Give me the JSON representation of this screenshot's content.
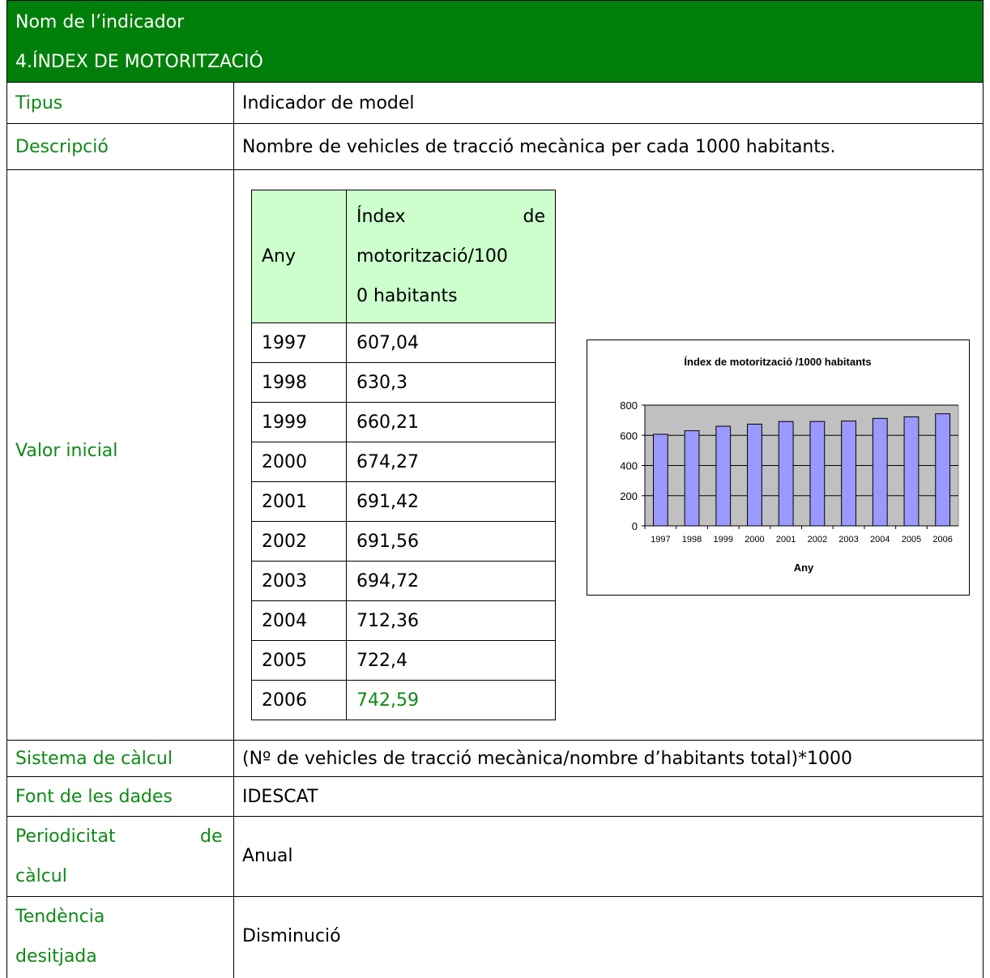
{
  "header": {
    "label": "Nom de l’indicador",
    "name": "4.ÍNDEX DE  MOTORITZACIÓ"
  },
  "rows": {
    "tipus": {
      "label": "Tipus",
      "value": "Indicador de model"
    },
    "descripcio": {
      "label": "Descripció",
      "value": "Nombre de vehicles de tracció mecànica per cada 1000 habitants."
    },
    "valor_inicial": {
      "label": "Valor inicial"
    },
    "sistema": {
      "label": "Sistema de càlcul",
      "value": "(Nº de vehicles de tracció mecànica/nombre d’habitants total)*1000"
    },
    "font": {
      "label": "Font de les dades",
      "value": "IDESCAT"
    },
    "periodicitat": {
      "label_1": "Periodicitat",
      "label_2": "de",
      "label_3": "càlcul",
      "value": "Anual"
    },
    "tendencia": {
      "label_1": "Tendència",
      "label_2": "desitjada",
      "value": "Disminució"
    }
  },
  "table": {
    "col_any": "Any",
    "col_index_1": "Índex",
    "col_index_2": "de",
    "col_index_3": "motorització/100",
    "col_index_4": "0 habitants",
    "rows": [
      {
        "any": "1997",
        "valor": "607,04"
      },
      {
        "any": "1998",
        "valor": "630,3"
      },
      {
        "any": "1999",
        "valor": "660,21"
      },
      {
        "any": "2000",
        "valor": "674,27"
      },
      {
        "any": "2001",
        "valor": "691,42"
      },
      {
        "any": "2002",
        "valor": "691,56"
      },
      {
        "any": "2003",
        "valor": "694,72"
      },
      {
        "any": "2004",
        "valor": "712,36"
      },
      {
        "any": "2005",
        "valor": "722,4"
      },
      {
        "any": "2006",
        "valor": "742,59"
      }
    ]
  },
  "colors": {
    "header_bg": "#00800a",
    "label_green": "#0e8a16",
    "table_header_bg": "#ccffcc",
    "bar_fill": "#9999ff",
    "plot_bg": "#c0c0c0"
  },
  "chart_data": {
    "type": "bar",
    "title": "Índex de motorització /1000 habitants",
    "xlabel": "Any",
    "ylabel": "",
    "categories": [
      "1997",
      "1998",
      "1999",
      "2000",
      "2001",
      "2002",
      "2003",
      "2004",
      "2005",
      "2006"
    ],
    "values": [
      607.04,
      630.3,
      660.21,
      674.27,
      691.42,
      691.56,
      694.72,
      712.36,
      722.4,
      742.59
    ],
    "ylim": [
      0,
      800
    ],
    "yticks": [
      "0",
      "200",
      "400",
      "600",
      "800"
    ],
    "grid": true,
    "legend": "none"
  }
}
